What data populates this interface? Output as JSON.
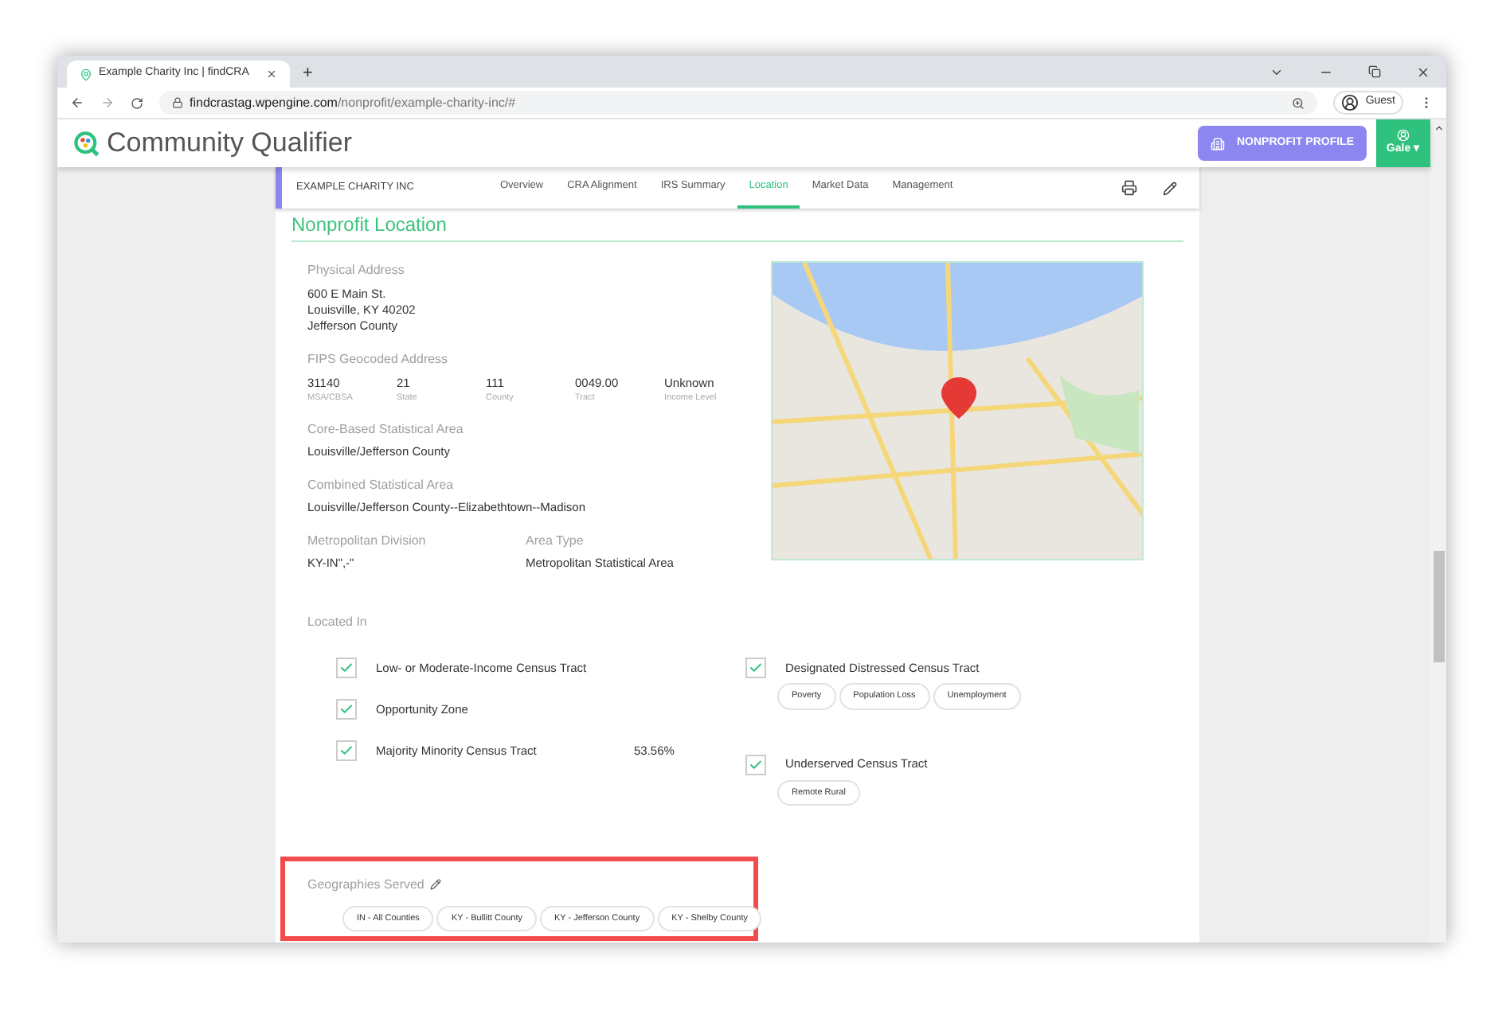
{
  "browser": {
    "tab_title": "Example Charity Inc | findCRA",
    "new_tab": "+",
    "url_host": "findcrastag.wpengine.com",
    "url_path": "/nonprofit/example-charity-inc/#",
    "profile": "Guest"
  },
  "app": {
    "brand": "Community Qualifier",
    "profile_button": "NONPROFIT PROFILE",
    "user": "Gale",
    "user_caret": "▾"
  },
  "org_nav": {
    "org_name": "EXAMPLE CHARITY INC",
    "tabs": [
      {
        "label": "Overview",
        "selected": false
      },
      {
        "label": "CRA Alignment",
        "selected": false
      },
      {
        "label": "IRS Summary",
        "selected": false
      },
      {
        "label": "Location",
        "selected": true
      },
      {
        "label": "Market Data",
        "selected": false
      },
      {
        "label": "Management",
        "selected": false
      }
    ]
  },
  "section_title": "Nonprofit Location",
  "physical_address": {
    "label": "Physical Address",
    "lines": [
      "600 E Main St.",
      "Louisville, KY 40202",
      "Jefferson County"
    ]
  },
  "fips": {
    "label": "FIPS Geocoded Address",
    "fields": [
      {
        "value": "31140",
        "caption": "MSA/CBSA"
      },
      {
        "value": "21",
        "caption": "State"
      },
      {
        "value": "111",
        "caption": "County"
      },
      {
        "value": "0049.00",
        "caption": "Tract"
      },
      {
        "value": "Unknown",
        "caption": "Income Level"
      }
    ]
  },
  "cbsa": {
    "label": "Core-Based Statistical Area",
    "value": "Louisville/Jefferson County"
  },
  "csa": {
    "label": "Combined Statistical Area",
    "value": "Louisville/Jefferson County--Elizabethtown--Madison"
  },
  "metro_division": {
    "label": "Metropolitan Division",
    "value": "KY-IN\",-\""
  },
  "area_type": {
    "label": "Area Type",
    "value": "Metropolitan Statistical Area"
  },
  "located_in": {
    "label": "Located In",
    "left": [
      {
        "label": "Low- or Moderate-Income Census Tract",
        "checked": true
      },
      {
        "label": "Opportunity Zone",
        "checked": true
      },
      {
        "label": "Majority Minority Census Tract",
        "checked": true,
        "value": "53.56%"
      }
    ],
    "right": [
      {
        "label": "Designated Distressed Census Tract",
        "checked": true,
        "tags": [
          "Poverty",
          "Population Loss",
          "Unemployment"
        ]
      },
      {
        "label": "Underserved Census Tract",
        "checked": true,
        "tags": [
          "Remote Rural"
        ]
      }
    ]
  },
  "geographies": {
    "label": "Geographies Served",
    "tags": [
      "IN - All Counties",
      "KY - Bullitt County",
      "KY - Jefferson County",
      "KY - Shelby County"
    ]
  }
}
